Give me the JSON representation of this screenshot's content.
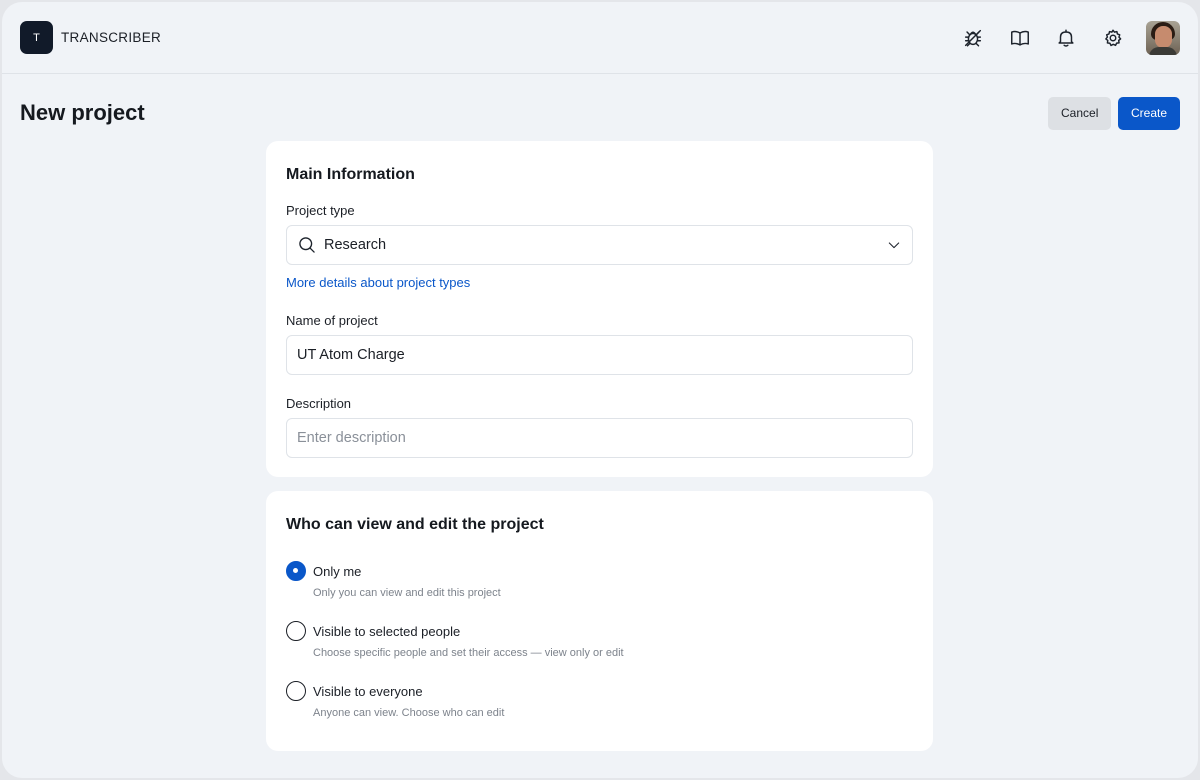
{
  "app": {
    "logo_letter": "T",
    "name": "TRANSCRIBER"
  },
  "header_icons": [
    "bug-icon",
    "book-icon",
    "bell-icon",
    "gear-icon"
  ],
  "page": {
    "title": "New project",
    "cancel_label": "Cancel",
    "create_label": "Create"
  },
  "main_info": {
    "title": "Main Information",
    "project_type_label": "Project type",
    "project_type_value": "Research",
    "project_types_link": "More details about project types",
    "name_label": "Name of project",
    "name_value": "UT Atom Charge",
    "description_label": "Description",
    "description_placeholder": "Enter description"
  },
  "access": {
    "title": "Who can view and edit the project",
    "options": [
      {
        "label": "Only me",
        "description": "Only you can view and edit this project",
        "selected": true
      },
      {
        "label": "Visible to selected people",
        "description": "Choose specific people and set their access — view only or edit",
        "selected": false
      },
      {
        "label": "Visible to everyone",
        "description": "Anyone can view. Choose who can edit",
        "selected": false
      }
    ]
  },
  "colors": {
    "primary": "#0a57c9",
    "background": "#f0f3f7",
    "logo_bg": "#111a29"
  }
}
